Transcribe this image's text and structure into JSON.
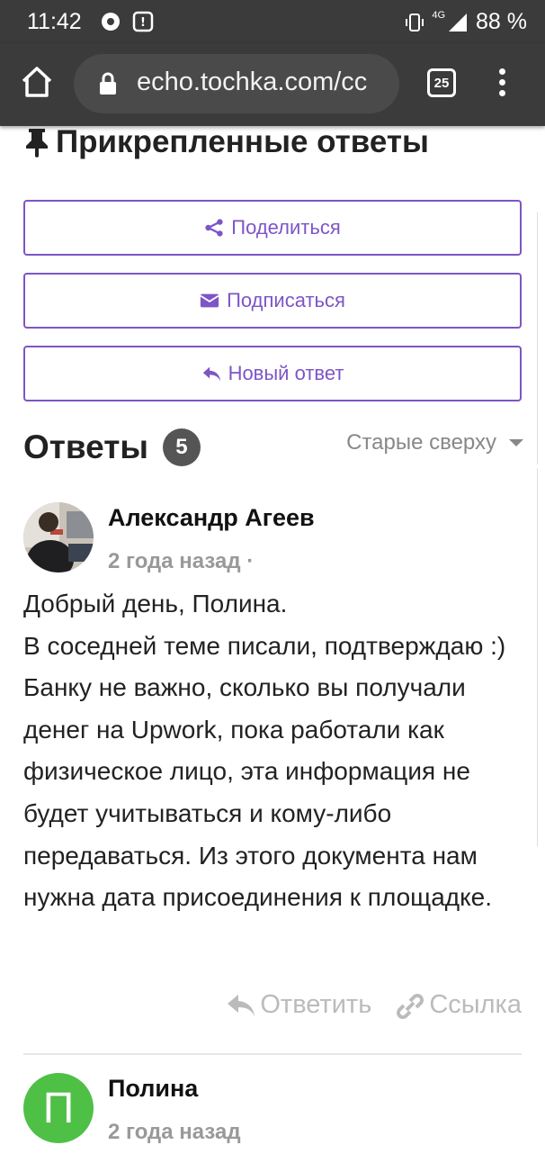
{
  "status_bar": {
    "time": "11:42",
    "network": "4G",
    "battery": "88 %"
  },
  "browser": {
    "url": "echo.tochka.com/cc",
    "tab_count": "25"
  },
  "pinned": {
    "title": "Прикрепленные ответы"
  },
  "actions": {
    "share": "Поделиться",
    "subscribe": "Подписаться",
    "new_answer": "Новый ответ"
  },
  "answers": {
    "title": "Ответы",
    "count": "5",
    "sort": "Старые сверху"
  },
  "posts": [
    {
      "author": "Александр Агеев",
      "ago": "2 года назад",
      "separator": "·",
      "lines": [
        "Добрый день, Полина.",
        "В соседней теме писали, подтверждаю :)",
        "Банку не важно, сколько вы получали денег на Upwork, пока работали как физическое лицо, эта информация не будет учитываться и кому-либо передаваться. Из этого документа нам нужна дата присоединения к площадке."
      ],
      "reply": "Ответить",
      "link": "Ссылка"
    },
    {
      "author": "Полина",
      "ago": "2 года назад",
      "avatar_letter": "П"
    }
  ],
  "colors": {
    "accent": "#7d55c7",
    "browser_bar": "#3b3b3b",
    "avatar_green": "#4ec046"
  }
}
